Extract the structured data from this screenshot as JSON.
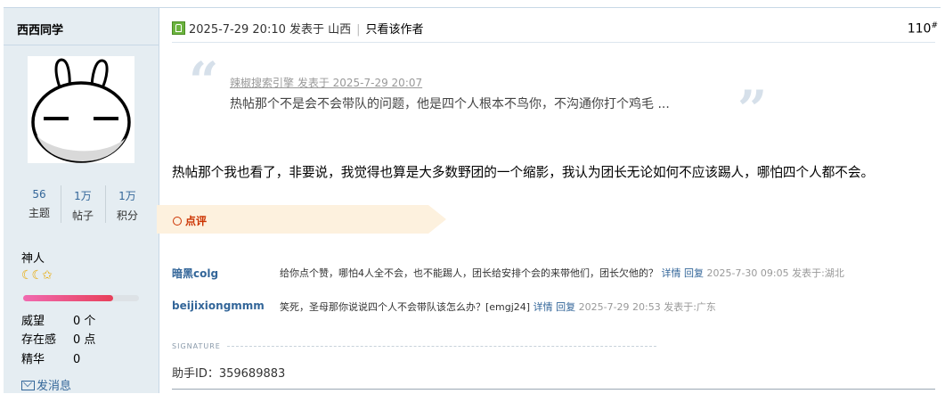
{
  "author": {
    "name": "西西同学",
    "stats": [
      {
        "value": "56",
        "label": "主题"
      },
      {
        "value": "1万",
        "label": "帖子"
      },
      {
        "value": "1万",
        "label": "积分"
      }
    ],
    "rank_title": "神人",
    "rank_icons": "☾☾✩",
    "rank_progress": 0.78,
    "props": [
      {
        "key": "威望",
        "value": "0 个"
      },
      {
        "key": "存在感",
        "value": "0 点"
      },
      {
        "key": "精华",
        "value": "0"
      }
    ],
    "send_message": "发消息"
  },
  "post": {
    "meta": "2025-7-29 20:10 发表于 山西",
    "separator": "|",
    "only_author": "只看该作者",
    "floor": "110",
    "floor_mark": "#",
    "quote": {
      "meta": "辣椒搜索引擎 发表于 2025-7-29 20:07",
      "text": "热帖那个不是会不会带队的问题，他是四个人根本不鸟你，不沟通你打个鸡毛 ..."
    },
    "body": "热帖那个我也看了，非要说，我觉得也算是大多数野团的一个缩影，我认为团长无论如何不应该踢人，哪怕四个人都不会。",
    "comment_title": "点评",
    "comments": [
      {
        "user": "暗黑colg",
        "text": "给你点个赞，哪怕4人全不会，也不能踢人，团长给安排个会的来带他们，团长欠他的？",
        "detail": "详情",
        "reply": "回复",
        "time": "2025-7-30 09:05 发表于:湖北"
      },
      {
        "user": "beijixiongmmm",
        "text": "笑死，圣母那你说说四个人不会带队该怎么办？[emgj24]",
        "detail": "详情",
        "reply": "回复",
        "time": "2025-7-29 20:53 发表于:广东"
      }
    ],
    "signature_label": "SIGNATURE",
    "signature": "助手ID：359689883"
  },
  "colors": {
    "sidebar_bg": "#e5edf2",
    "link": "#336699",
    "comment_accent": "#cc3300",
    "banner_bg": "#fdf1de"
  }
}
